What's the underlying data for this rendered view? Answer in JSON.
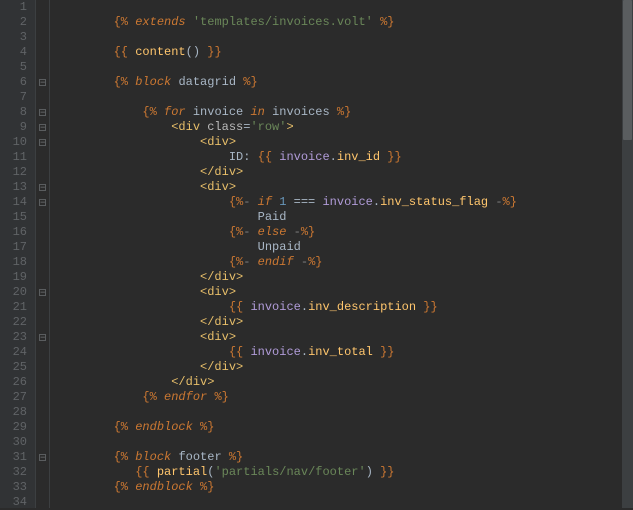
{
  "lines": [
    {
      "num": "1",
      "code": ""
    },
    {
      "num": "2",
      "code": "        <span class='delim'>{%</span> <span class='kw'>extends</span> <span class='str'>'templates/invoices.volt'</span> <span class='delim'>%}</span>"
    },
    {
      "num": "3",
      "code": ""
    },
    {
      "num": "4",
      "code": "        <span class='delim'>{{</span> <span class='fn'>content</span><span class='punct'>()</span> <span class='delim'>}}</span>"
    },
    {
      "num": "5",
      "code": ""
    },
    {
      "num": "6",
      "code": "        <span class='delim'>{%</span> <span class='kw'>block</span> <span class='txt'>datagrid</span> <span class='delim'>%}</span>"
    },
    {
      "num": "7",
      "code": ""
    },
    {
      "num": "8",
      "code": "            <span class='delim'>{%</span> <span class='kw'>for</span> <span class='txt'>invoice</span> <span class='kw'>in</span> <span class='txt'>invoices</span> <span class='delim'>%}</span>"
    },
    {
      "num": "9",
      "code": "                <span class='tag'>&lt;div</span> <span class='attr'>class</span><span class='punct'>=</span><span class='str'>'row'</span><span class='tag'>&gt;</span>"
    },
    {
      "num": "10",
      "code": "                    <span class='tag'>&lt;div&gt;</span>"
    },
    {
      "num": "11",
      "code": "                        <span class='txt'>ID:</span> <span class='delim'>{{</span> <span class='var'>invoice</span><span class='punct'>.</span><span class='prop'>inv_id</span> <span class='delim'>}}</span>"
    },
    {
      "num": "12",
      "code": "                    <span class='tag'>&lt;/div&gt;</span>"
    },
    {
      "num": "13",
      "code": "                    <span class='tag'>&lt;div&gt;</span>"
    },
    {
      "num": "14",
      "code": "                        <span class='delim'>{%</span><span class='wsdelim'>-</span> <span class='kw'>if</span> <span class='num'>1</span> <span class='punct'>===</span> <span class='var'>invoice</span><span class='punct'>.</span><span class='prop'>inv_status_flag</span> <span class='wsdelim'>-</span><span class='delim'>%}</span>"
    },
    {
      "num": "15",
      "code": "                            <span class='txt'>Paid</span>"
    },
    {
      "num": "16",
      "code": "                        <span class='delim'>{%</span><span class='wsdelim'>-</span> <span class='kw'>else</span> <span class='wsdelim'>-</span><span class='delim'>%}</span>"
    },
    {
      "num": "17",
      "code": "                            <span class='txt'>Unpaid</span>"
    },
    {
      "num": "18",
      "code": "                        <span class='delim'>{%</span><span class='wsdelim'>-</span> <span class='kw'>endif</span> <span class='wsdelim'>-</span><span class='delim'>%}</span>"
    },
    {
      "num": "19",
      "code": "                    <span class='tag'>&lt;/div&gt;</span>"
    },
    {
      "num": "20",
      "code": "                    <span class='tag'>&lt;div&gt;</span>"
    },
    {
      "num": "21",
      "code": "                        <span class='delim'>{{</span> <span class='var'>invoice</span><span class='punct'>.</span><span class='prop'>inv_description</span> <span class='delim'>}}</span>"
    },
    {
      "num": "22",
      "code": "                    <span class='tag'>&lt;/div&gt;</span>"
    },
    {
      "num": "23",
      "code": "                    <span class='tag'>&lt;div&gt;</span>"
    },
    {
      "num": "24",
      "code": "                        <span class='delim'>{{</span> <span class='var'>invoice</span><span class='punct'>.</span><span class='prop'>inv_total</span> <span class='delim'>}}</span>"
    },
    {
      "num": "25",
      "code": "                    <span class='tag'>&lt;/div&gt;</span>"
    },
    {
      "num": "26",
      "code": "                <span class='tag'>&lt;/div&gt;</span>"
    },
    {
      "num": "27",
      "code": "            <span class='delim'>{%</span> <span class='kw'>endfor</span> <span class='delim'>%}</span>"
    },
    {
      "num": "28",
      "code": ""
    },
    {
      "num": "29",
      "code": "        <span class='delim'>{%</span> <span class='kw'>endblock</span> <span class='delim'>%}</span>"
    },
    {
      "num": "30",
      "code": ""
    },
    {
      "num": "31",
      "code": "        <span class='delim'>{%</span> <span class='kw'>block</span> <span class='txt'>footer</span> <span class='delim'>%}</span>"
    },
    {
      "num": "32",
      "code": "           <span class='delim'>{{</span> <span class='fn'>partial</span><span class='punct'>(</span><span class='str'>'partials/nav/footer'</span><span class='punct'>)</span> <span class='delim'>}}</span>"
    },
    {
      "num": "33",
      "code": "        <span class='delim'>{%</span> <span class='kw'>endblock</span> <span class='delim'>%}</span>"
    },
    {
      "num": "34",
      "code": ""
    }
  ],
  "folds": [
    6,
    8,
    9,
    10,
    13,
    14,
    20,
    23,
    31
  ]
}
